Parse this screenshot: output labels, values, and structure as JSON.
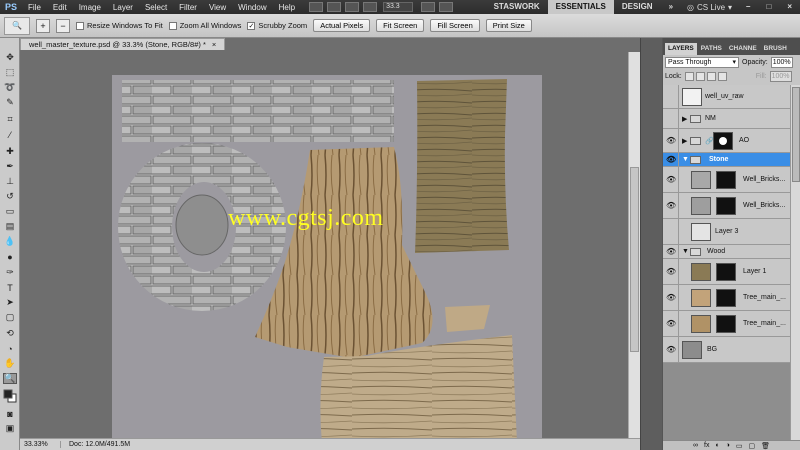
{
  "app": {
    "logo": "PS"
  },
  "menubar": {
    "items": [
      "File",
      "Edit",
      "Image",
      "Layer",
      "Select",
      "Filter",
      "View",
      "Window",
      "Help"
    ],
    "zoom_value": "33.3",
    "workspaces": [
      "STASWORK",
      "ESSENTIALS",
      "DESIGN"
    ],
    "active_workspace": "ESSENTIALS",
    "cslive": "CS Live"
  },
  "options": {
    "resize_windows": "Resize Windows To Fit",
    "zoom_all": "Zoom All Windows",
    "scrubby_zoom": "Scrubby Zoom",
    "actual_pixels": "Actual Pixels",
    "fit_screen": "Fit Screen",
    "fill_screen": "Fill Screen",
    "print_size": "Print Size"
  },
  "document": {
    "tab_title": "well_master_texture.psd @ 33.3% (Stone, RGB/8#) *",
    "close": "×",
    "watermark": "www.cgtsj.com"
  },
  "statusbar": {
    "zoom": "33.33%",
    "doc": "Doc: 12.0M/491.5M"
  },
  "layers_panel": {
    "tabs": [
      "LAYERS",
      "PATHS",
      "CHANNE",
      "BRUSH"
    ],
    "blend_mode": "Pass Through",
    "opacity_label": "Opacity:",
    "opacity_value": "100%",
    "lock_label": "Lock:",
    "fill_label": "Fill:",
    "fill_value": "100%",
    "layers": [
      {
        "name": "well_uv_raw",
        "visible": false,
        "kind": "layer"
      },
      {
        "name": "NM",
        "visible": false,
        "kind": "group"
      },
      {
        "name": "AO",
        "visible": true,
        "kind": "group"
      },
      {
        "name": "Stone",
        "visible": true,
        "kind": "group"
      },
      {
        "name": "Well_Bricks...",
        "visible": true,
        "kind": "layer"
      },
      {
        "name": "Well_Bricks...",
        "visible": false,
        "kind": "layer"
      },
      {
        "name": "Layer 3",
        "visible": false,
        "kind": "layer"
      },
      {
        "name": "Wood",
        "visible": true,
        "kind": "group"
      },
      {
        "name": "Layer 1",
        "visible": true,
        "kind": "layer"
      },
      {
        "name": "Tree_main_...",
        "visible": true,
        "kind": "layer"
      },
      {
        "name": "Tree_main_...",
        "visible": true,
        "kind": "layer"
      },
      {
        "name": "BG",
        "visible": true,
        "kind": "layer"
      }
    ],
    "bottom_icons": [
      "link-icon",
      "fx-icon",
      "mask-icon",
      "adjustment-icon",
      "folder-icon",
      "new-layer-icon",
      "trash-icon"
    ]
  },
  "colors": {
    "selection": "#3a8ee6",
    "watermark": "#ffff22",
    "canvas": "#9c9aa0"
  }
}
